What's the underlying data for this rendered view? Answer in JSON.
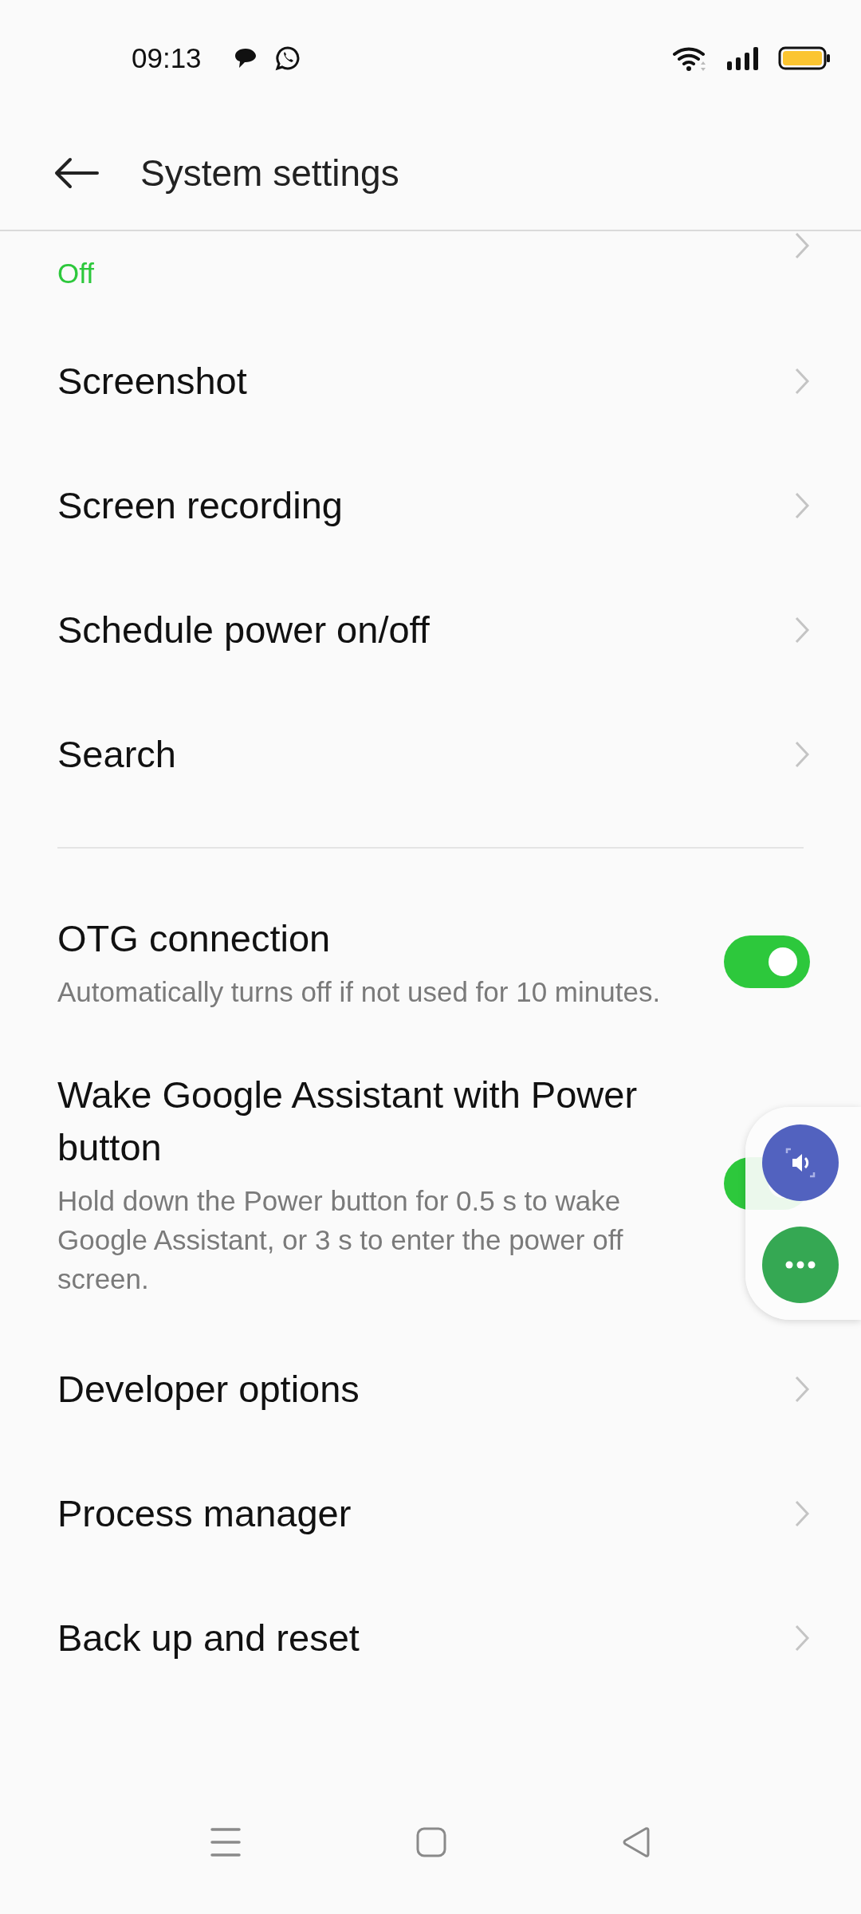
{
  "status_bar": {
    "time": "09:13"
  },
  "header": {
    "title": "System settings"
  },
  "items": [
    {
      "kind": "partial",
      "subtitle": "Off"
    },
    {
      "kind": "link",
      "title": "Screenshot"
    },
    {
      "kind": "link",
      "title": "Screen recording"
    },
    {
      "kind": "link",
      "title": "Schedule power on/off"
    },
    {
      "kind": "link",
      "title": "Search"
    },
    {
      "kind": "divider"
    },
    {
      "kind": "toggle",
      "title": "OTG connection",
      "subtitle": "Automatically turns off if not used for 10 minutes.",
      "on": true
    },
    {
      "kind": "toggle",
      "title": "Wake Google Assistant with Power button",
      "subtitle": "Hold down the Power button for 0.5 s to wake Google Assistant, or 3 s to enter the power off screen.",
      "on": true
    },
    {
      "kind": "link",
      "title": "Developer options"
    },
    {
      "kind": "link",
      "title": "Process manager"
    },
    {
      "kind": "link",
      "title": "Back up and reset"
    }
  ]
}
